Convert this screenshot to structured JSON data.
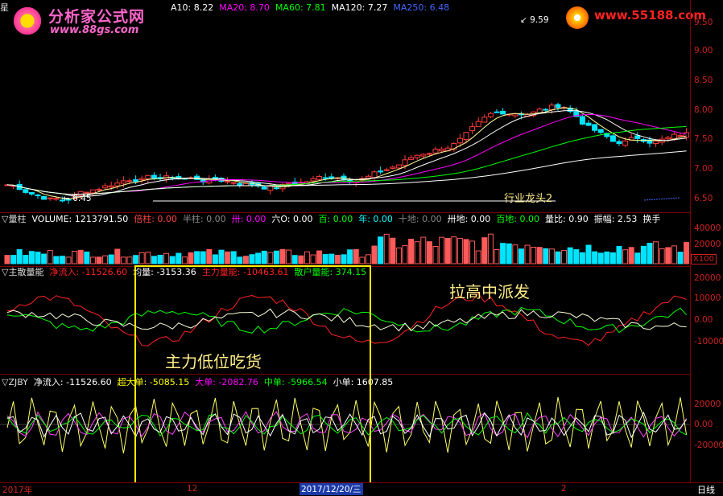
{
  "watermarks": {
    "logo_text": "分析家公式网",
    "logo_url": "www.88gs.com",
    "site_url": "www.55188.com"
  },
  "main_panel": {
    "prefix": "星",
    "legend": [
      {
        "label": "A10: 8.22",
        "color": "#ffffff"
      },
      {
        "label": "MA20: 8.70",
        "color": "#ff00ff"
      },
      {
        "label": "MA60: 7.81",
        "color": "#00ff00"
      },
      {
        "label": "MA120: 7.27",
        "color": "#ffffff"
      },
      {
        "label": "MA250: 6.48",
        "color": "#4466ff"
      }
    ],
    "high_label": "9.59",
    "low_label": "6.45",
    "caption": "行业龙头2",
    "y_ticks": [
      "9.50",
      "9.00",
      "8.50",
      "8.00",
      "7.50",
      "7.00",
      "6.50"
    ]
  },
  "volume_panel": {
    "items": [
      {
        "label": "▽量柱",
        "color": "#dddddd"
      },
      {
        "label": "VOLUME: 1213791.50",
        "color": "#ffffff"
      },
      {
        "label": "倍柱: 0.00",
        "color": "#ff4444"
      },
      {
        "label": "半柱: 0.00",
        "color": "#888888"
      },
      {
        "label": "卅: 0.00",
        "color": "#ff00ff"
      },
      {
        "label": "六O: 0.00",
        "color": "#ffffff"
      },
      {
        "label": "百: 0.00",
        "color": "#00ff00"
      },
      {
        "label": "年: 0.00",
        "color": "#00ffff"
      },
      {
        "label": "十地: 0.00",
        "color": "#888888"
      },
      {
        "label": "卅地: 0.00",
        "color": "#ffffff"
      },
      {
        "label": "百地: 0.00",
        "color": "#00ff00"
      },
      {
        "label": "量比: 0.90",
        "color": "#ffffff"
      },
      {
        "label": "振幅: 2.53",
        "color": "#ffffff"
      },
      {
        "label": "换手",
        "color": "#ffffff"
      }
    ],
    "y_ticks": [
      "40000",
      "20000"
    ],
    "unit": "X100"
  },
  "zsln_panel": {
    "items": [
      {
        "label": "▽主散量能",
        "color": "#dddddd"
      },
      {
        "label": "净流入: -11526.60",
        "color": "#ff2222"
      },
      {
        "label": "均量: -3153.36",
        "color": "#ffffff"
      },
      {
        "label": "主力量能: -10463.61",
        "color": "#ff2222"
      },
      {
        "label": "散户量能: 374.15",
        "color": "#00ff00"
      }
    ],
    "y_ticks": [
      "20000",
      "10000",
      "0.00",
      "-10000"
    ]
  },
  "zjby_panel": {
    "items": [
      {
        "label": "▽ZJBY",
        "color": "#dddddd"
      },
      {
        "label": "净流入: -11526.60",
        "color": "#ffffff"
      },
      {
        "label": "超大单: -5085.15",
        "color": "#ffff00"
      },
      {
        "label": "大单: -2082.76",
        "color": "#ff00ff"
      },
      {
        "label": "中单: -5966.54",
        "color": "#00ff00"
      },
      {
        "label": "小单: 1607.85",
        "color": "#ffffff"
      }
    ],
    "y_ticks": [
      "20000",
      "0.00",
      "-20000"
    ]
  },
  "annotations": {
    "accumulate": "主力低位吃货",
    "distribute": "拉高中派发"
  },
  "time_axis": {
    "start_label": "2017年",
    "mid_label": "12",
    "cursor_date": "2017/12/20/三",
    "next_label": "2",
    "period": "日线"
  }
}
